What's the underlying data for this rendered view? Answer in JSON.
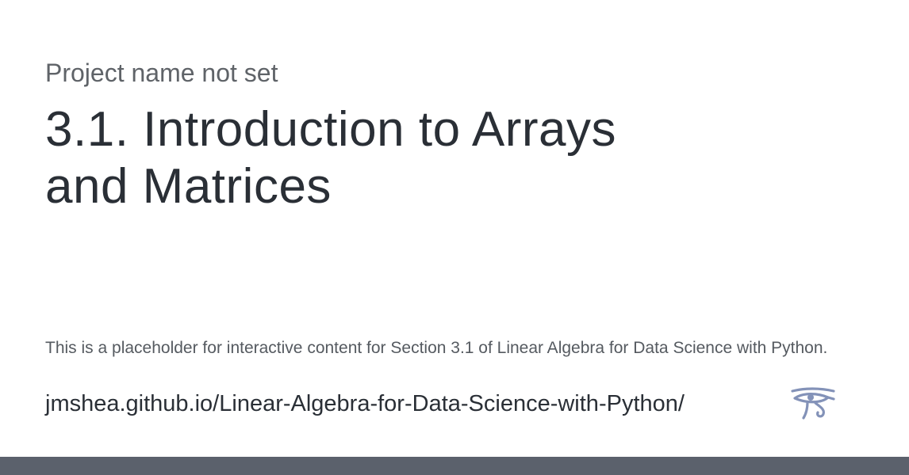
{
  "card": {
    "project_name": "Project name not set",
    "title": "3.1. Introduction to Arrays and Matrices",
    "description": "This is a placeholder for interactive content for Section 3.1 of Linear Algebra for Data Science with Python.",
    "url": "jmshea.github.io/Linear-Algebra-for-Data-Science-with-Python/",
    "icon": "eye-of-horus-icon"
  },
  "colors": {
    "title": "#2a2f36",
    "muted_text": "#5f6368",
    "icon": "#8392b8",
    "bottom_bar": "#5b616c",
    "background": "#ffffff"
  }
}
